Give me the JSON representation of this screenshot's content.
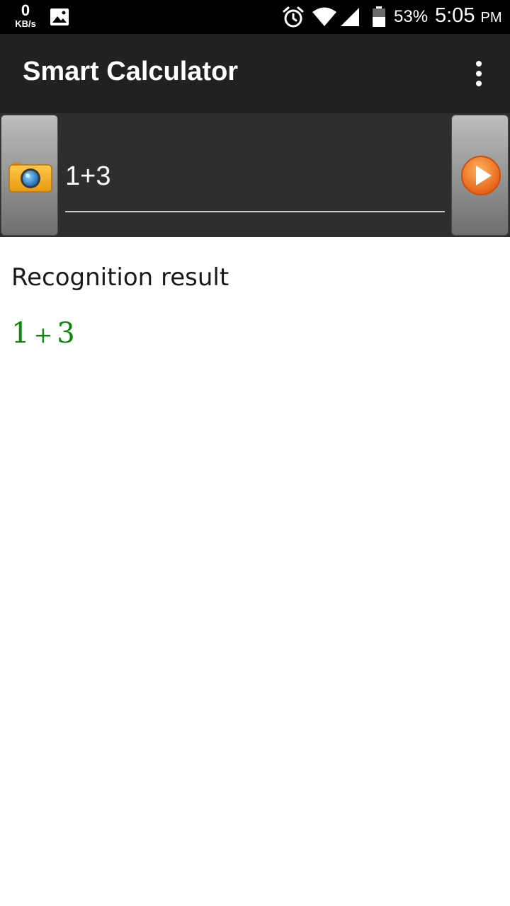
{
  "status_bar": {
    "net_speed_value": "0",
    "net_speed_unit": "KB/s",
    "battery_percent": "53%",
    "time": "5:05",
    "ampm": "PM",
    "icons": [
      "gallery-icon",
      "alarm-icon",
      "wifi-icon",
      "signal-icon",
      "battery-icon"
    ]
  },
  "app_bar": {
    "title": "Smart Calculator",
    "overflow_icon": "overflow-menu-icon"
  },
  "input_bar": {
    "camera_icon": "camera-icon",
    "expression_value": "1+3",
    "go_icon": "play-icon"
  },
  "result": {
    "heading": "Recognition result",
    "formula": {
      "left": "1",
      "operator": "+",
      "right": "3"
    }
  },
  "colors": {
    "status_bar_bg": "#000000",
    "app_bar_bg": "#212121",
    "input_bar_bg": "#2e2e2e",
    "result_formula": "#0a8a0a",
    "go_button_accent": "#f07018"
  }
}
